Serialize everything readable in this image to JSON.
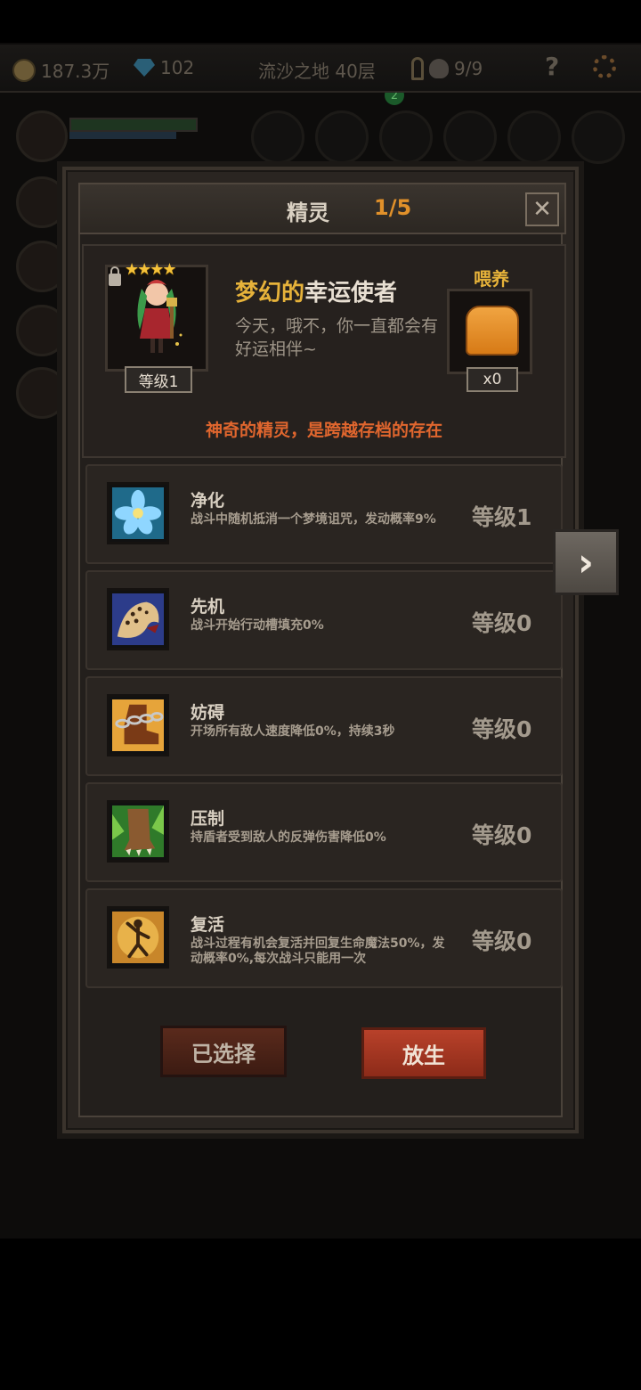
{
  "topbar": {
    "gold": "187.3万",
    "gems": "102",
    "location": "流沙之地 40层",
    "keys": "9/9",
    "help": "?",
    "badge": "2"
  },
  "dialog": {
    "title": "精灵",
    "count": "1/5",
    "close": "✕"
  },
  "spirit": {
    "stars": "★★★★",
    "level": "等级1",
    "name_adj": "梦幻的",
    "name": "幸运使者",
    "description": "今天，哦不，你一直都会有好运相伴~",
    "feed_label": "喂养",
    "feed_count": "x0",
    "tagline": "神奇的精灵，是跨越存档的存在"
  },
  "skills": [
    {
      "name": "净化",
      "desc": "战斗中随机抵消一个梦境诅咒，发动概率9%",
      "level": "等级1",
      "icon": "blue-flower-icon"
    },
    {
      "name": "先机",
      "desc": "战斗开始行动槽填充0%",
      "level": "等级0",
      "icon": "leopard-icon"
    },
    {
      "name": "妨碍",
      "desc": "开场所有敌人速度降低0%，持续3秒",
      "level": "等级0",
      "icon": "chained-boot-icon"
    },
    {
      "name": "压制",
      "desc": "持盾者受到敌人的反弹伤害降低0%",
      "level": "等级0",
      "icon": "beast-claw-icon"
    },
    {
      "name": "复活",
      "desc": "战斗过程有机会复活并回复生命魔法50%，发动概率0%,每次战斗只能用一次",
      "level": "等级0",
      "icon": "revive-figure-icon"
    }
  ],
  "buttons": {
    "selected": "已选择",
    "release": "放生"
  },
  "nav": {
    "next": "›"
  },
  "colors": {
    "accent_orange": "#e0902a",
    "gold_text": "#e6b23a",
    "tagline": "#e0662e",
    "release_button": "#b8412a"
  }
}
